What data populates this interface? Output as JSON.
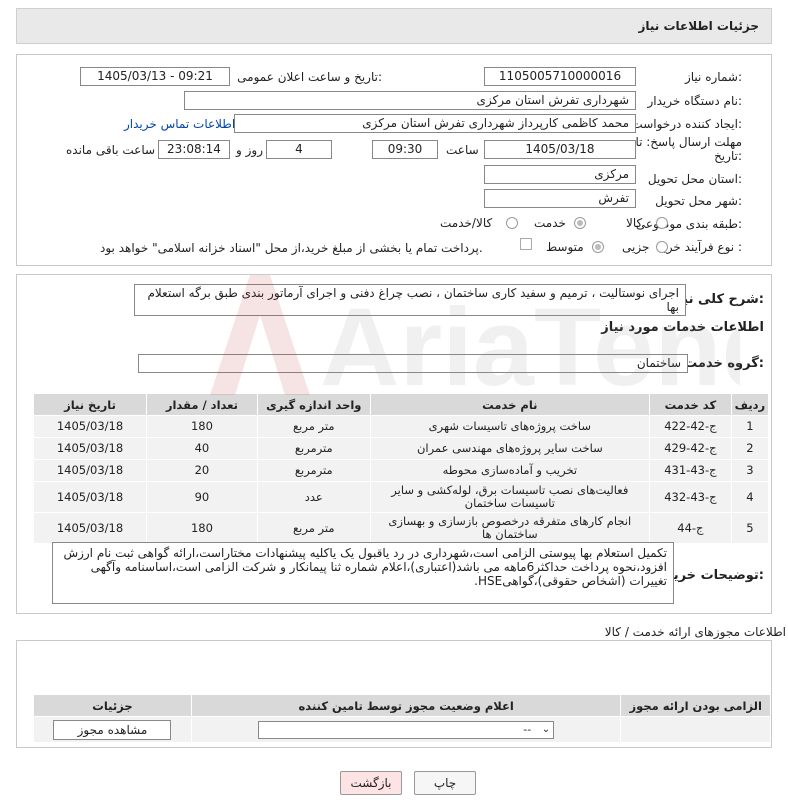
{
  "header": {
    "title": "جزئیات اطلاعات نیاز"
  },
  "form": {
    "need_number_label": "شماره نیاز:",
    "need_number": "1105005710000016",
    "announce_label": "تاریخ و ساعت اعلان عمومی:",
    "announce_value": "1405/03/13 - 09:21",
    "buyer_org_label": "نام دستگاه خریدار:",
    "buyer_org": "شهرداری تفرش استان مرکزی",
    "requester_label": "ایجاد کننده درخواست:",
    "requester": "محمد کاظمی کارپرداز شهرداری تفرش استان مرکزی",
    "contact_link": "اطلاعات تماس خریدار",
    "deadline_label": "مهلت ارسال پاسخ: تا تاریخ:",
    "deadline_date": "1405/03/18",
    "time_label": "ساعت",
    "deadline_time": "09:30",
    "days_value": "4",
    "days_label": "روز و",
    "remaining_time": "23:08:14",
    "remaining_label": "ساعت باقی مانده",
    "province_label": "استان محل تحویل:",
    "province": "مرکزی",
    "city_label": "شهر محل تحویل:",
    "city": "تفرش",
    "category_label": "طبقه بندی موضوعی:",
    "category_options": [
      "کالا",
      "خدمت",
      "کالا/خدمت"
    ],
    "process_label": "نوع فرآیند خرید :",
    "process_options": [
      "جزیی",
      "متوسط"
    ],
    "payment_note": "پرداخت تمام یا بخشی از مبلغ خرید،از محل \"اسناد خزانه اسلامی\" خواهد بود."
  },
  "summary": {
    "label": "شرح کلی نیاز:",
    "text": "اجرای نوستالیت ، ترمیم و سفید کاری ساختمان ، نصب چراغ دفنی و اجرای آرماتور بندی طبق برگه استعلام بها"
  },
  "services": {
    "section_title": "اطلاعات خدمات مورد نیاز",
    "group_label": "گروه خدمت:",
    "group_value": "ساختمان",
    "columns": [
      "ردیف",
      "کد خدمت",
      "نام خدمت",
      "واحد اندازه گیری",
      "تعداد / مقدار",
      "تاریخ نیاز"
    ],
    "rows": [
      [
        "1",
        "ج-42-422",
        "ساخت پروژه‌های تاسیسات شهری",
        "متر مربع",
        "180",
        "1405/03/18"
      ],
      [
        "2",
        "ج-42-429",
        "ساخت سایر پروژه‌های مهندسی عمران",
        "مترمربع",
        "40",
        "1405/03/18"
      ],
      [
        "3",
        "ج-43-431",
        "تخریب و آماده‌سازی محوطه",
        "مترمربع",
        "20",
        "1405/03/18"
      ],
      [
        "4",
        "ج-43-432",
        "فعالیت‌های نصب تاسیسات برق، لوله‌کشی و سایر تاسیسات ساختمان",
        "عدد",
        "90",
        "1405/03/18"
      ],
      [
        "5",
        "ج-44",
        "انجام کارهای متفرقه درخصوص بازسازی و بهسازی ساختمان ها",
        "متر مربع",
        "180",
        "1405/03/18"
      ]
    ]
  },
  "buyer_notes": {
    "label": "توضیحات خریدار:",
    "text": "تکمیل استعلام بها پیوستی الزامی است،شهرداری در رد یاقبول یک یاکلیه پیشنهادات مختاراست،ارائه گواهی ثبت نام ارزش افزود،نحوه پرداخت حداکثر6ماهه می باشد(اعتباری)،اعلام شماره ثنا پیمانکار و شرکت الزامی است،اساسنامه وآگهی تغییرات (اشخاص حقوقی)،گواهیHSE."
  },
  "permits": {
    "section_title": "اطلاعات مجوزهای ارائه خدمت / کالا",
    "columns": [
      "الزامی بودن ارائه مجوز",
      "اعلام وضعیت مجوز توسط تامین کننده",
      "جزئیات"
    ],
    "select_value": "--",
    "view_button": "مشاهده مجوز"
  },
  "footer": {
    "print_button": "چاپ",
    "back_button": "بازگشت"
  },
  "watermark": "AriaTender.neT"
}
